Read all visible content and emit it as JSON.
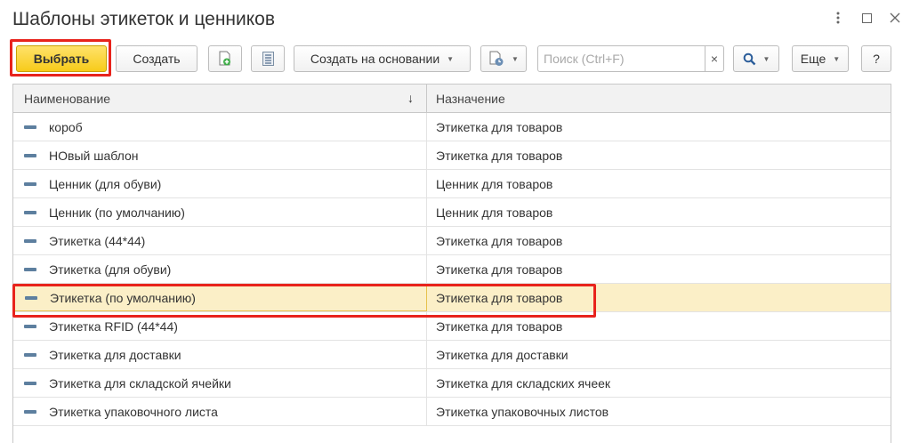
{
  "window": {
    "title": "Шаблоны этикеток и ценников",
    "controls": [
      "more-icon",
      "maximize-icon",
      "close-icon"
    ]
  },
  "toolbar": {
    "select_label": "Выбрать",
    "create_label": "Создать",
    "create_based_label": "Создать на основании",
    "search_placeholder": "Поиск (Ctrl+F)",
    "search_clear": "×",
    "more_label": "Еще",
    "help_label": "?"
  },
  "table": {
    "columns": [
      "Наименование",
      "Назначение"
    ],
    "sort_indicator": "↓",
    "selected_row": 6,
    "rows": [
      {
        "name": "короб",
        "purpose": "Этикетка для товаров"
      },
      {
        "name": "НОвый шаблон",
        "purpose": "Этикетка для товаров"
      },
      {
        "name": "Ценник (для обуви)",
        "purpose": "Ценник для товаров"
      },
      {
        "name": "Ценник (по умолчанию)",
        "purpose": "Ценник для товаров"
      },
      {
        "name": "Этикетка (44*44)",
        "purpose": "Этикетка для товаров"
      },
      {
        "name": "Этикетка (для обуви)",
        "purpose": "Этикетка для товаров"
      },
      {
        "name": "Этикетка (по умолчанию)",
        "purpose": "Этикетка для товаров"
      },
      {
        "name": "Этикетка RFID (44*44)",
        "purpose": "Этикетка для товаров"
      },
      {
        "name": "Этикетка для доставки",
        "purpose": "Этикетка для доставки"
      },
      {
        "name": "Этикетка для складской ячейки",
        "purpose": "Этикетка для складских ячеек"
      },
      {
        "name": "Этикетка упаковочного листа",
        "purpose": "Этикетка упаковочных листов"
      }
    ]
  },
  "colors": {
    "accent_yellow": "#f7cb1a",
    "highlight_red": "#e8231c",
    "selected_row": "#fbefc7"
  }
}
